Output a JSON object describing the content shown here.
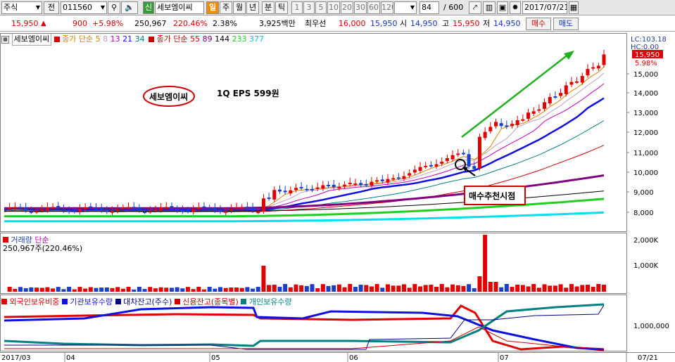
{
  "toolbar": {
    "market": "주식",
    "market_dropdown": "전",
    "code": "011560",
    "flag": "신",
    "stock_name": "세보엠이씨",
    "period_active": "일",
    "period_week": "주",
    "period_month": "월",
    "period_year": "년",
    "period_min": "분",
    "period_tick": "틱",
    "intervals": [
      "1",
      "3",
      "5",
      "10",
      "20",
      "30",
      "60",
      "120"
    ],
    "count": "84",
    "total": "/ 600",
    "date": "2017/07/21"
  },
  "quote": {
    "price": "15,950",
    "arrow": "▲",
    "change": "900",
    "change_pct": "+5.98%",
    "volume": "250,967",
    "volume_pct": "220.46%",
    "turnover": "2.38%",
    "amount": "3,925백만",
    "best_label": "최우선",
    "ask": "16,000",
    "bid": "15,950",
    "open_label": "시",
    "open": "14,950",
    "high_label": "고",
    "high": "15,950",
    "low_label": "저",
    "low": "14,950",
    "buy_button": "매수",
    "sell_button": "매도"
  },
  "price_panel": {
    "name_label": "세보엠이씨",
    "ma_short_label": "종가 단순",
    "ma_short_periods": [
      "5",
      "8",
      "13",
      "21",
      "34"
    ],
    "ma_long_label": "종가 단순",
    "ma_long_periods": [
      "55",
      "89",
      "144",
      "233",
      "377"
    ],
    "lc_label": "LC:103.18",
    "hc_label": "HC:0.00",
    "current_price_tag": "15,950",
    "current_pct_tag": "5.98%",
    "y_ticks": [
      "15,000",
      "14,000",
      "13,000",
      "12,000",
      "11,000",
      "10,000",
      "9,000",
      "8,000"
    ],
    "annotation_name": "세보엠이씨",
    "annotation_eps": "1Q EPS 599원",
    "annotation_buy": "매수추천시점"
  },
  "volume_panel": {
    "title_label": "거래량",
    "title_type": "단순",
    "value": "250,967주(220.46%)",
    "y_ticks": [
      "2,000K",
      "1,000K"
    ]
  },
  "investor_panel": {
    "legend": [
      "외국인보유비중",
      "기관보유수량",
      "대차잔고(주수)",
      "신용잔고(종목별)",
      "개인보유수량"
    ],
    "y_tick": "1,000,000"
  },
  "x_axis": {
    "labels": [
      "2017/03",
      "04",
      "05",
      "06",
      "07",
      "07/21"
    ]
  },
  "colors": {
    "up": "#e00000",
    "down": "#1a3ec8",
    "ma5": "#e08000",
    "ma8": "#c0a0c0",
    "ma13": "#c000c0",
    "ma21": "#1010e0",
    "ma34": "#008080",
    "ma55": "#d00000",
    "ma89": "#800080",
    "ma144": "#000000",
    "ma233": "#20d020",
    "ma377": "#00e0f0"
  }
}
